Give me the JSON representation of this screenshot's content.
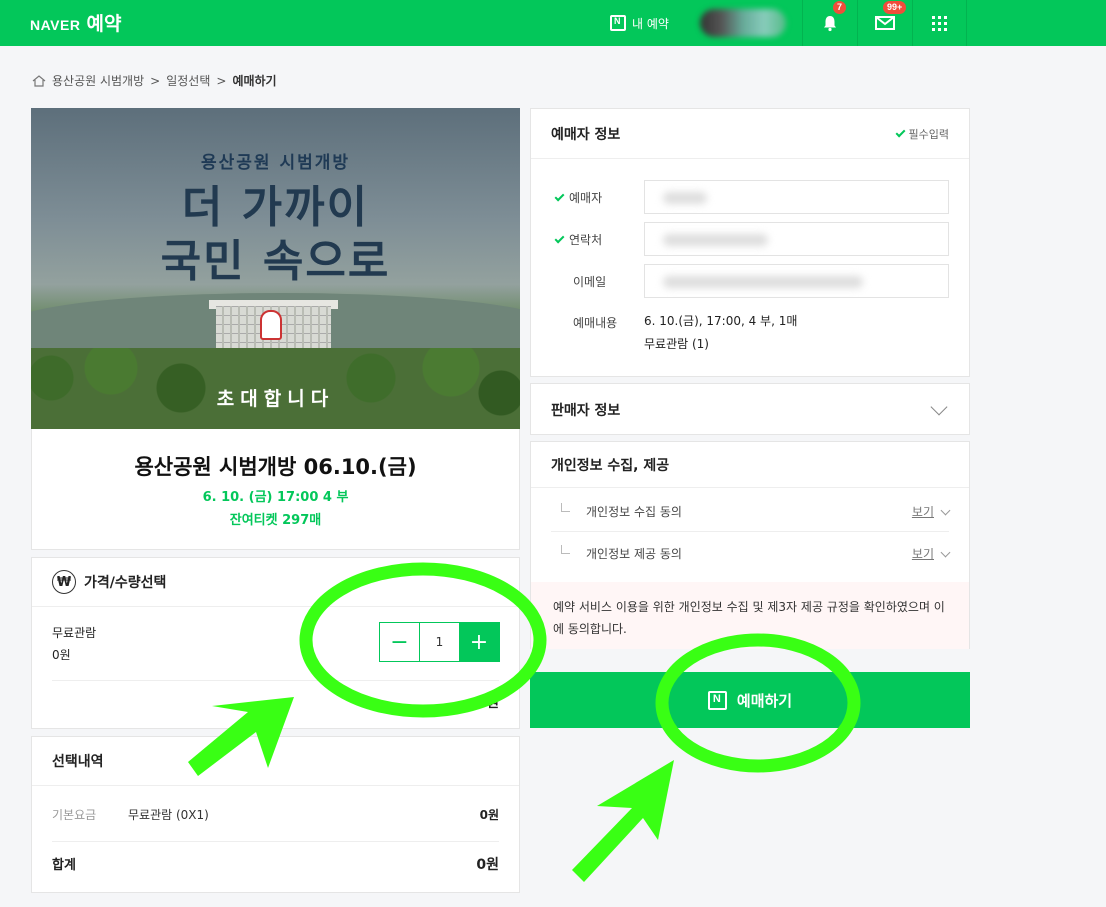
{
  "header": {
    "brand": "NAVER",
    "service": "예약",
    "my_reservations": "내 예약",
    "notification_count": "7",
    "mail_count": "99+"
  },
  "breadcrumb": {
    "items": [
      "용산공원 시범개방",
      "일정선택"
    ],
    "separator": ">",
    "current": "예매하기"
  },
  "poster": {
    "subtitle": "용산공원 시범개방",
    "line1": "더 가까이",
    "line2": "국민 속으로",
    "invite": "초대합니다"
  },
  "event": {
    "title": "용산공원 시범개방 06.10.(금)",
    "when": "6. 10. (금) 17:00 4 부",
    "remaining": "잔여티켓 297매"
  },
  "price_section": {
    "title": "가격/수량선택",
    "ticket_name": "무료관람",
    "ticket_price": "0원",
    "quantity": "1",
    "subtotal": "0원"
  },
  "selection": {
    "title": "선택내역",
    "base_label": "기본요금",
    "base_item": "무료관람 (0X1)",
    "base_amount": "0원",
    "total_label": "합계",
    "total_amount": "0원"
  },
  "buyer": {
    "title": "예매자 정보",
    "required_label": "필수입력",
    "name_label": "예매자",
    "phone_label": "연락처",
    "email_label": "이메일",
    "detail_label": "예매내용",
    "detail_line1": "6. 10.(금), 17:00, 4 부, 1매",
    "detail_line2": "무료관람 (1)"
  },
  "seller": {
    "title": "판매자 정보"
  },
  "privacy": {
    "title": "개인정보 수집, 제공",
    "collect_label": "개인정보 수집 동의",
    "provide_label": "개인정보 제공 동의",
    "view_label": "보기",
    "agree_text": "예약 서비스 이용을 위한 개인정보 수집 및 제3자 제공 규정을 확인하였으며 이에 동의합니다."
  },
  "book_button": {
    "label": "예매하기"
  },
  "colors": {
    "brand_green": "#03c75a",
    "annotation_green": "#39ff14"
  }
}
